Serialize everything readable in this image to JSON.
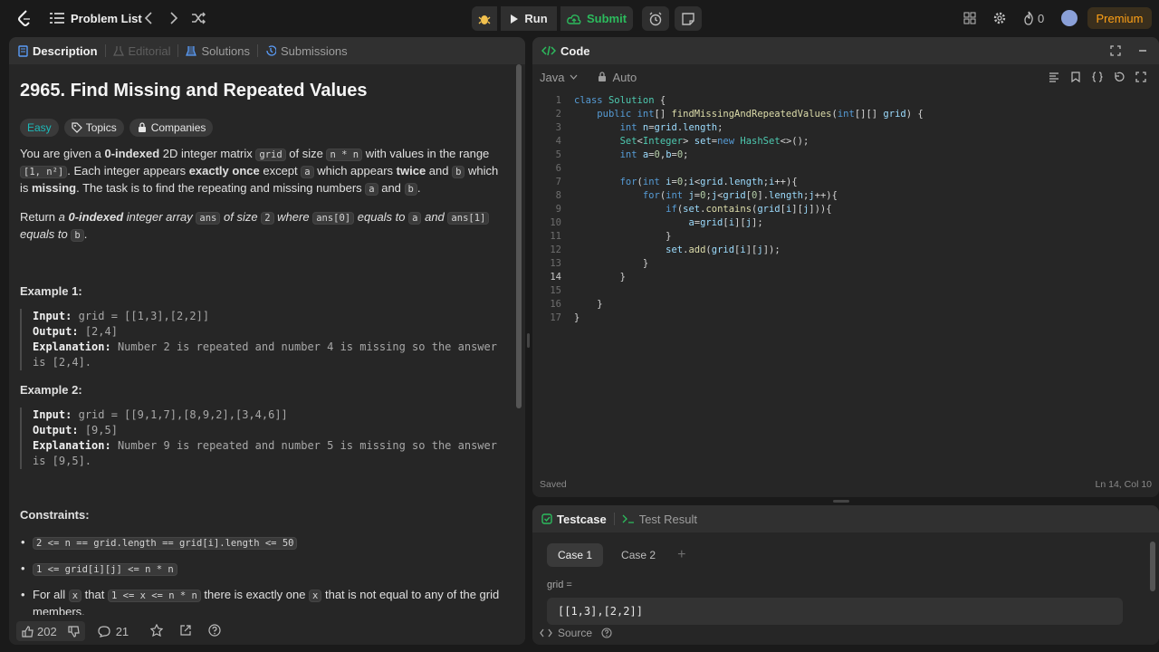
{
  "nav": {
    "problem_list": "Problem List",
    "run": "Run",
    "submit": "Submit",
    "streak": "0",
    "premium": "Premium"
  },
  "left": {
    "tabs": [
      "Description",
      "Editorial",
      "Solutions",
      "Submissions"
    ],
    "title": "2965. Find Missing and Repeated Values",
    "difficulty": "Easy",
    "topics": "Topics",
    "companies": "Companies",
    "example1": {
      "heading": "Example 1:",
      "input_label": "Input:",
      "input": "grid = [[1,3],[2,2]]",
      "output_label": "Output:",
      "output": "[2,4]",
      "expl_label": "Explanation:",
      "expl": "Number 2 is repeated and number 4 is missing so the answer is [2,4]."
    },
    "example2": {
      "heading": "Example 2:",
      "input_label": "Input:",
      "input": "grid = [[9,1,7],[8,9,2],[3,4,6]]",
      "output_label": "Output:",
      "output": "[9,5]",
      "expl_label": "Explanation:",
      "expl": "Number 9 is repeated and number 5 is missing so the answer is [9,5]."
    },
    "constraints_heading": "Constraints:",
    "constraints": [
      "2 <= n == grid.length == grid[i].length <= 50",
      "1 <= grid[i][j] <= n * n"
    ],
    "likes": "202",
    "comments": "21"
  },
  "code": {
    "header": "Code",
    "language": "Java",
    "mode": "Auto",
    "status": "Saved",
    "cursor": "Ln 14, Col 10"
  },
  "test": {
    "tabs": [
      "Testcase",
      "Test Result"
    ],
    "cases": [
      "Case 1",
      "Case 2"
    ],
    "param": "grid =",
    "value": "[[1,3],[2,2]]",
    "source": "Source"
  }
}
